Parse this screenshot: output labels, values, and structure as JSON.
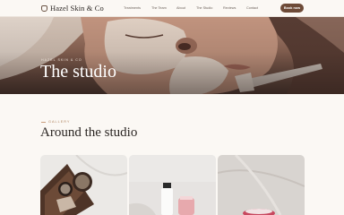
{
  "nav": {
    "logo": "Hazel Skin & Co",
    "links": [
      "Treatments",
      "The Team",
      "About",
      "The Studio",
      "Reviews",
      "Contact"
    ],
    "book_label": "Book now"
  },
  "hero": {
    "kicker": "HAZEL SKIN & CO",
    "title": "The studio"
  },
  "gallery": {
    "kicker": "GALLERY",
    "title": "Around the studio"
  },
  "colors": {
    "accent": "#6d4a37",
    "background": "#fbf8f4",
    "kicker": "#b0845f"
  }
}
